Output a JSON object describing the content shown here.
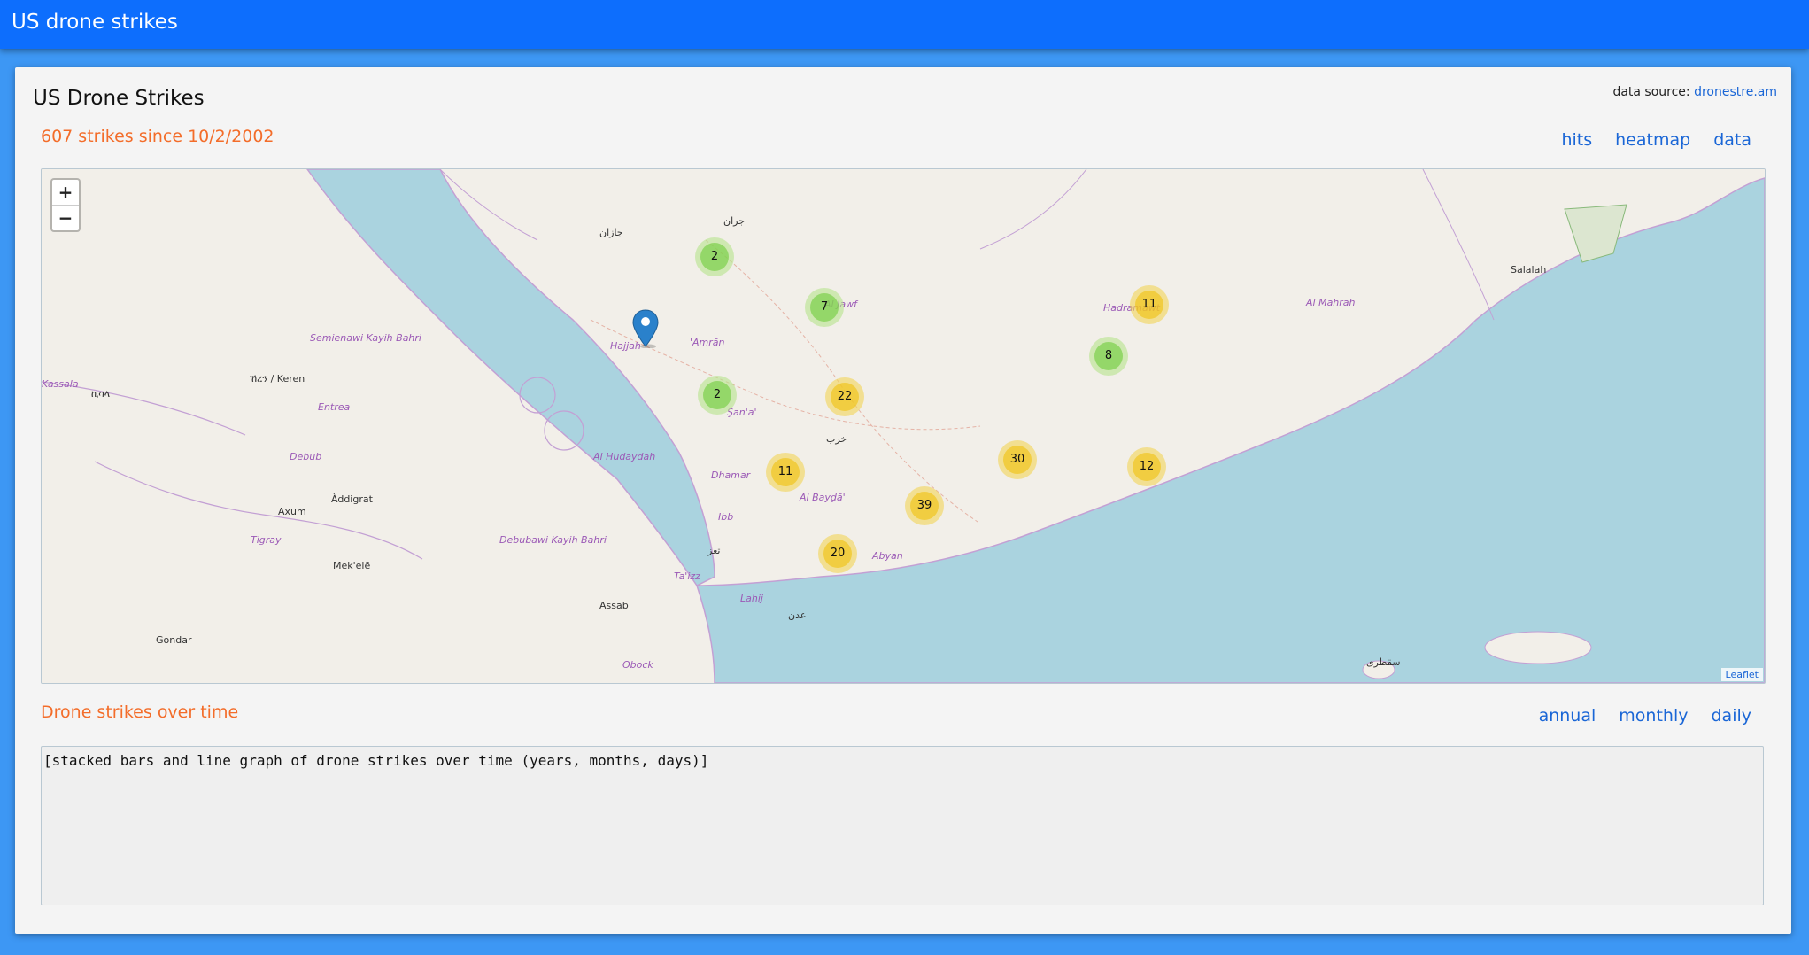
{
  "app": {
    "title": "US drone strikes"
  },
  "card": {
    "title": "US Drone Strikes",
    "source_label": "data source:",
    "source_link": "dronestre.am"
  },
  "map_section": {
    "subtitle": "607 strikes since 10/2/2002",
    "tabs": [
      "hits",
      "heatmap",
      "data"
    ],
    "zoom_in": "+",
    "zoom_out": "−",
    "attribution": "Leaflet",
    "clusters": [
      {
        "count": "2",
        "size": "small"
      },
      {
        "count": "7",
        "size": "small"
      },
      {
        "count": "2",
        "size": "small"
      },
      {
        "count": "22",
        "size": "medium"
      },
      {
        "count": "11",
        "size": "medium"
      },
      {
        "count": "8",
        "size": "small"
      },
      {
        "count": "30",
        "size": "medium"
      },
      {
        "count": "12",
        "size": "medium"
      },
      {
        "count": "11",
        "size": "medium"
      },
      {
        "count": "39",
        "size": "medium"
      },
      {
        "count": "20",
        "size": "medium"
      }
    ],
    "labels": [
      "Semienawi Kayih Bahri",
      "Entrea",
      "Debub",
      "Tigray",
      "Axum",
      "Àddigrat",
      "Mek'elē",
      "Gondar",
      "ኪሳላ",
      "Kassala",
      "ኸረን / Keren",
      "Debubawi Kayih Bahri",
      "Assab",
      "Obock",
      "Al Hudaydah",
      "Hajjah",
      "'Amrān",
      "Şan'a'",
      "Dhamar",
      "Al Bayḑā'",
      "Ibb",
      "Ta'izz",
      "Lahij",
      "عدن",
      "Abyan",
      "Al Jawf",
      "Hadramawt",
      "Al Mahrah",
      "Salalah",
      "جران",
      "جازان",
      "تعز",
      "خرب",
      "سقطرى"
    ]
  },
  "chart_section": {
    "subtitle": "Drone strikes over time",
    "tabs": [
      "annual",
      "monthly",
      "daily"
    ],
    "placeholder": "[stacked bars and line graph of drone strikes over time (years, months, days)]"
  },
  "colors": {
    "topbar": "#0d6efd",
    "background": "#3d97f4",
    "accent_orange": "#f36d2a",
    "link_blue": "#1a66d6",
    "sea": "#aad3df",
    "land": "#f2efe9",
    "cluster_small": "#6ecc39",
    "cluster_medium": "#f0c20c"
  }
}
